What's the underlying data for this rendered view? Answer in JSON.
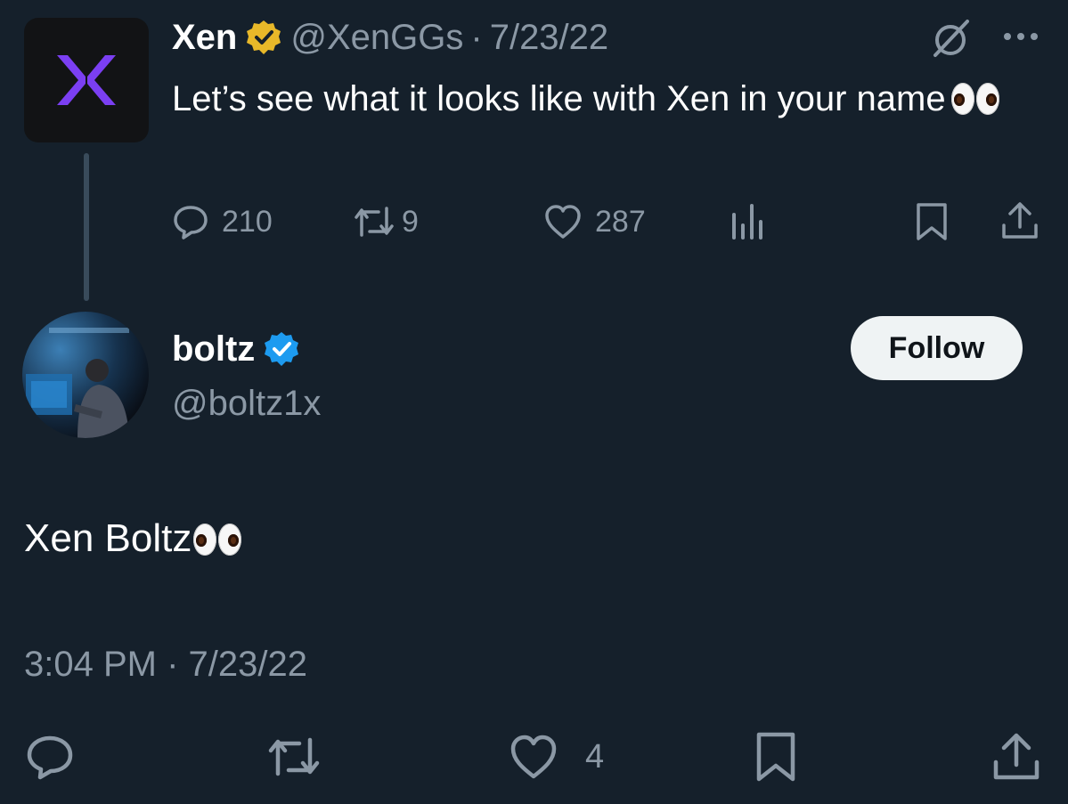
{
  "parent_tweet": {
    "author_name": "Xen",
    "handle": "@XenGGs",
    "separator": "·",
    "date": "7/23/22",
    "text": "Let’s see what it looks like with Xen in your name",
    "emoji": "eyes",
    "stats": {
      "replies": "210",
      "reposts": "9",
      "likes": "287"
    },
    "verified_badge_color": "#e8b829"
  },
  "main_tweet": {
    "author_name": "boltz",
    "handle": "@boltz1x",
    "follow_label": "Follow",
    "text": "Xen Boltz",
    "emoji": "eyes",
    "time": "3:04 PM",
    "separator": "·",
    "date": "7/23/22",
    "stats": {
      "likes": "4"
    },
    "verified_badge_color": "#1d9bf0"
  },
  "colors": {
    "background": "#15202b",
    "muted_text": "#8b98a5",
    "accent_logo": "#7b3ff2",
    "follow_button_bg": "#eff3f4"
  },
  "icons": [
    "reply-icon",
    "repost-icon",
    "like-icon",
    "views-icon",
    "bookmark-icon",
    "share-icon",
    "grok-icon",
    "more-icon",
    "verified-badge-icon"
  ]
}
